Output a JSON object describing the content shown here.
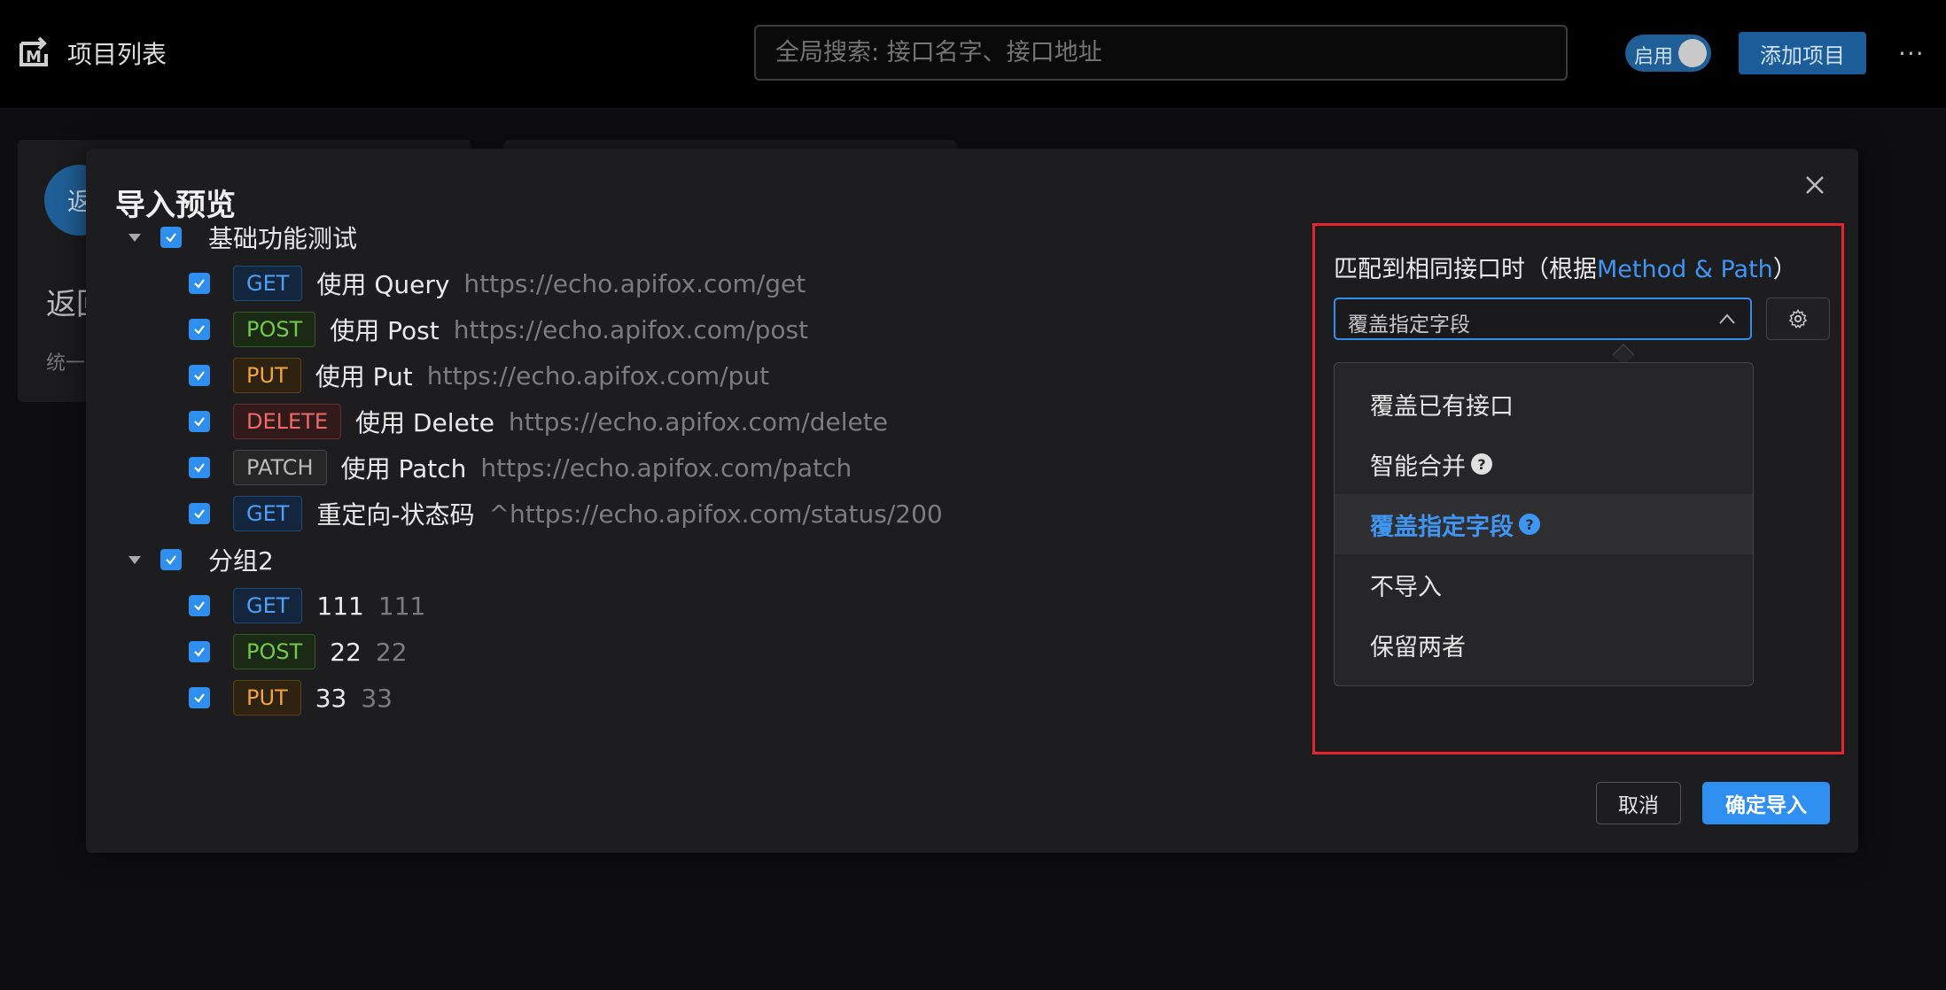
{
  "header": {
    "app_title": "项目列表",
    "search_placeholder": "全局搜索: 接口名字、接口地址",
    "toggle_label": "启用",
    "add_project_label": "添加项目",
    "more_label": "···"
  },
  "background": {
    "avatar_text": "返",
    "card_title": "返回",
    "card_desc": "统一"
  },
  "modal": {
    "title": "导入预览",
    "groups": [
      {
        "label": "基础功能测试",
        "checked": true,
        "items": [
          {
            "method": "GET",
            "name": "使用 Query",
            "url": "https://echo.apifox.com/get",
            "checked": true
          },
          {
            "method": "POST",
            "name": "使用 Post",
            "url": "https://echo.apifox.com/post",
            "checked": true
          },
          {
            "method": "PUT",
            "name": "使用 Put",
            "url": "https://echo.apifox.com/put",
            "checked": true
          },
          {
            "method": "DELETE",
            "name": "使用 Delete",
            "url": "https://echo.apifox.com/delete",
            "checked": true
          },
          {
            "method": "PATCH",
            "name": "使用 Patch",
            "url": "https://echo.apifox.com/patch",
            "checked": true
          },
          {
            "method": "GET",
            "name": "重定向-状态码",
            "url": "^https://echo.apifox.com/status/200",
            "checked": true
          }
        ]
      },
      {
        "label": "分组2",
        "checked": true,
        "items": [
          {
            "method": "GET",
            "name": "111",
            "url": "111",
            "checked": true
          },
          {
            "method": "POST",
            "name": "22",
            "url": "22",
            "checked": true
          },
          {
            "method": "PUT",
            "name": "33",
            "url": "33",
            "checked": true
          }
        ]
      }
    ],
    "match": {
      "label_prefix": "匹配到相同接口时（根据",
      "label_highlight": "Method & Path",
      "label_suffix": "）",
      "selected_value": "覆盖指定字段",
      "options": [
        {
          "label": "覆盖已有接口",
          "help": false,
          "selected": false
        },
        {
          "label": "智能合并",
          "help": true,
          "selected": false
        },
        {
          "label": "覆盖指定字段",
          "help": true,
          "selected": true
        },
        {
          "label": "不导入",
          "help": false,
          "selected": false
        },
        {
          "label": "保留两者",
          "help": false,
          "selected": false
        }
      ]
    },
    "cancel_label": "取消",
    "confirm_label": "确定导入"
  },
  "colors": {
    "accent": "#2f8ff0",
    "highlight_box": "#e5262d",
    "get": "#4ea0f5",
    "post": "#73c94a",
    "put": "#f2a33a",
    "delete": "#ee6a6a",
    "patch": "#b9b9b9"
  }
}
